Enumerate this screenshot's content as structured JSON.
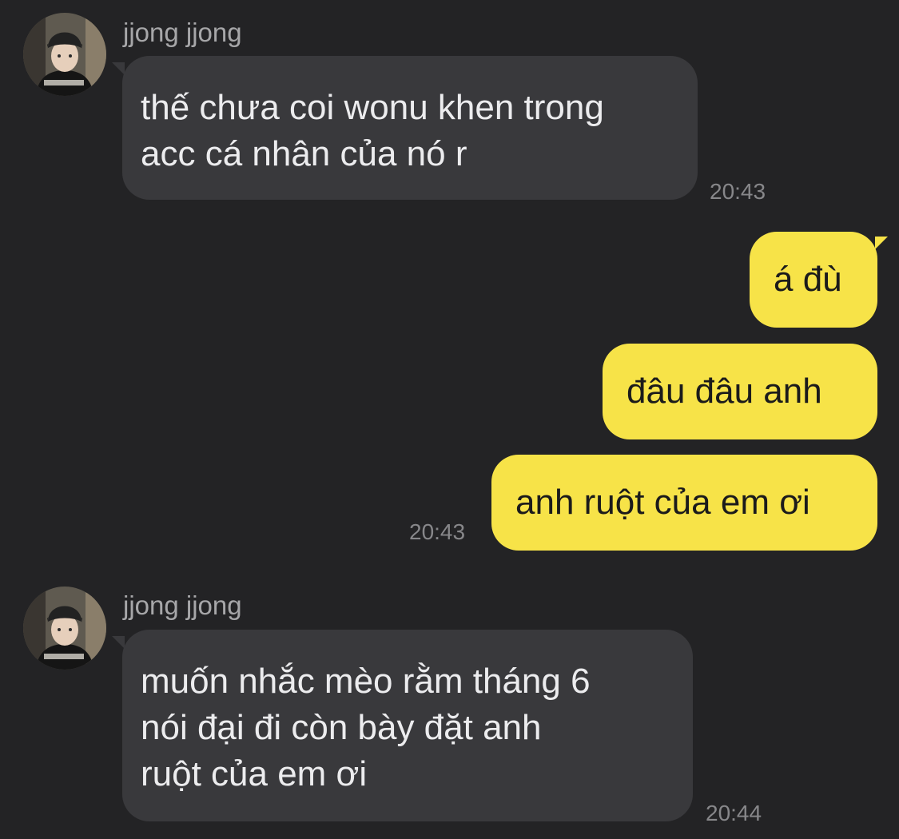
{
  "messages": [
    {
      "direction": "incoming",
      "sender": "jjong jjong",
      "avatar_icon": "profile-photo",
      "lines": [
        "thế chưa coi wonu khen trong",
        "acc cá nhân của nó r"
      ],
      "time": "20:43"
    },
    {
      "direction": "outgoing",
      "lines": [
        "á đù"
      ]
    },
    {
      "direction": "outgoing",
      "lines": [
        "đâu đâu anh"
      ]
    },
    {
      "direction": "outgoing",
      "lines": [
        "anh ruột của em ơi"
      ],
      "time": "20:43"
    },
    {
      "direction": "incoming",
      "sender": "jjong jjong",
      "avatar_icon": "profile-photo",
      "lines": [
        "muốn nhắc mèo rằm tháng 6",
        "nói đại đi còn bày đặt anh",
        "ruột của em ơi"
      ],
      "time": "20:44"
    }
  ],
  "colors": {
    "background": "#232325",
    "incoming_bubble": "#39393c",
    "outgoing_bubble": "#f7e348",
    "sender_text": "#a7a7a9",
    "timestamp_text": "#87878a"
  }
}
